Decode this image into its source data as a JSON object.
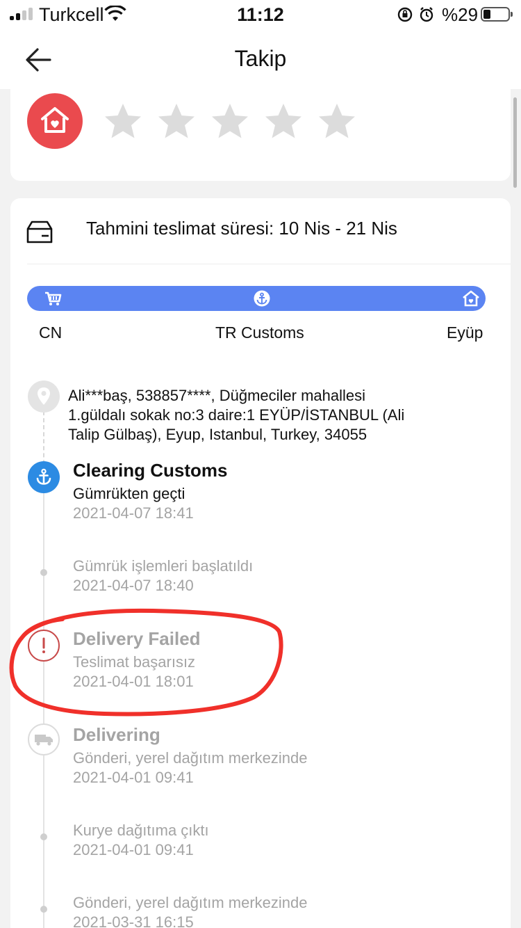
{
  "status_bar": {
    "carrier": "Turkcell",
    "time": "11:12",
    "battery_percent": "%29",
    "battery_level": 0.29
  },
  "nav": {
    "title": "Takip",
    "back_icon": "arrow-left-icon"
  },
  "rating": {
    "store_icon": "home-heart-icon",
    "stars_total": 5,
    "stars_filled": 0
  },
  "shipping": {
    "eta_icon": "package-box-icon",
    "eta_text": "Tahmini teslimat süresi: 10 Nis - 21 Nis",
    "progress": {
      "stages": [
        {
          "label": "CN",
          "icon": "cart-icon"
        },
        {
          "label": "TR Customs",
          "icon": "anchor-icon"
        },
        {
          "label": "Eyüp",
          "icon": "home-heart-icon"
        }
      ]
    }
  },
  "address": {
    "line1": "Ali***baş,  538857****,  Düğmeciler mahallesi",
    "line2": "1.güldalı sokak no:3 daire:1 EYÜP/İSTANBUL (Ali",
    "line3": "Talip Gülbaş),  Eyup,  Istanbul,  Turkey,  34055"
  },
  "timeline": [
    {
      "title": "Clearing Customs",
      "desc": "Gümrükten geçti",
      "time": "2021-04-07 18:41",
      "icon": "anchor-icon"
    },
    {
      "title": "",
      "desc": "Gümrük işlemleri başlatıldı",
      "time": "2021-04-07 18:40",
      "icon": "dot"
    },
    {
      "title": "Delivery Failed",
      "desc": "Teslimat başarısız",
      "time": "2021-04-01 18:01",
      "icon": "exclamation-icon"
    },
    {
      "title": "Delivering",
      "desc": "Gönderi, yerel dağıtım merkezinde",
      "time": "2021-04-01 09:41",
      "icon": "truck-icon"
    },
    {
      "title": "",
      "desc": "Kurye dağıtıma çıktı",
      "time": "2021-04-01 09:41",
      "icon": "dot"
    },
    {
      "title": "",
      "desc": "Gönderi, yerel dağıtım merkezinde",
      "time": "2021-03-31 16:15",
      "icon": "dot"
    }
  ],
  "colors": {
    "accent_blue": "#2c8be3",
    "progress_blue": "#5b84f2",
    "store_red": "#ea4a4e",
    "annotation_red": "#f0302a",
    "muted_text": "#a4a4a4"
  }
}
